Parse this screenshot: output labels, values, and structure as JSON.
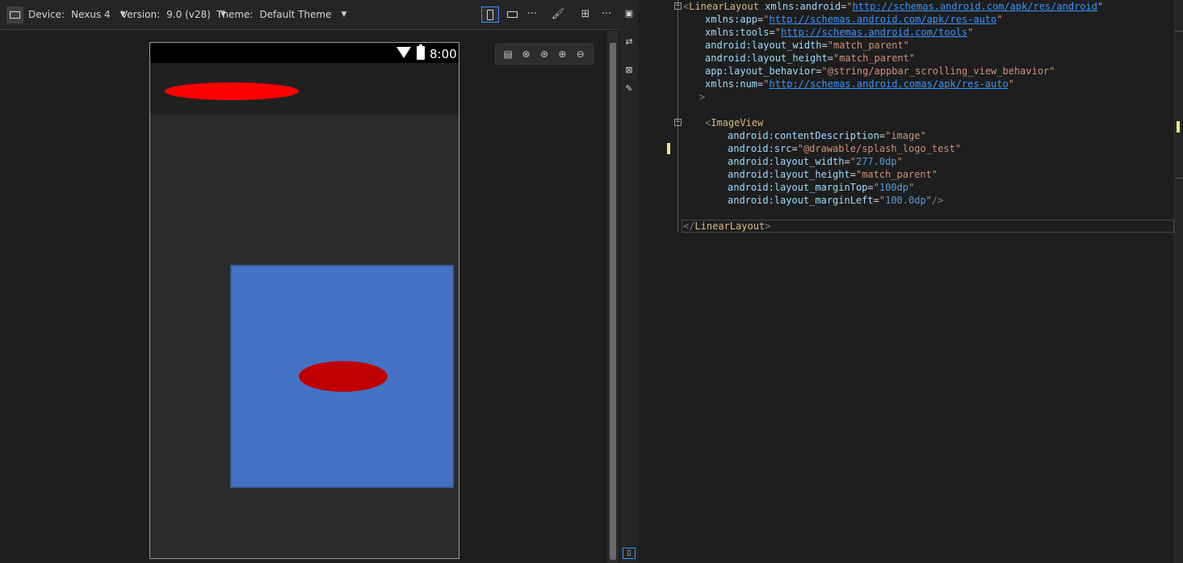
{
  "toolbar": {
    "device_label": "Device:",
    "device_value": "Nexus 4",
    "version_label": "Version:",
    "version_value": "9.0 (v28)",
    "theme_label": "Theme:",
    "theme_value": "Default Theme",
    "more1": "···",
    "more2": "···"
  },
  "phone": {
    "clock": "8:00",
    "image_color": "#4472c4",
    "ellipse_color": "#c00000"
  },
  "code": {
    "l1_open": "<",
    "l1_el": "LinearLayout",
    "l1_attr": "xmlns:android",
    "l1_url": "http://schemas.android.com/apk/res/android",
    "l2_attr": "xmlns:app",
    "l2_url": "http://schemas.android.com/apk/res-auto",
    "l3_attr": "xmlns:tools",
    "l3_url": "http://schemas.android.com/tools",
    "l4_attr": "android:layout_width",
    "l4_val": "match_parent",
    "l5_attr": "android:layout_height",
    "l5_val": "match_parent",
    "l6_attr": "app:layout_behavior",
    "l6_val": "@string/appbar_scrolling_view_behavior",
    "l7_attr": "xmlns:num",
    "l7_url": "http://schemas.android.comas/apk/res-auto",
    "l8": ">",
    "l10_el": "ImageView",
    "l11_attr": "android:contentDescription",
    "l11_val": "image",
    "l12_attr": "android:src",
    "l12_val": "@drawable/splash_logo_test",
    "l13_attr": "android:layout_width",
    "l13_val": "277.0dp",
    "l14_attr": "android:layout_height",
    "l14_val": "match_parent",
    "l15_attr": "android:layout_marginTop",
    "l15_val": "100dp",
    "l16_attr": "android:layout_marginLeft",
    "l16_val": "100.0dp",
    "l16_end": "/>",
    "l18_el": "LinearLayout"
  }
}
